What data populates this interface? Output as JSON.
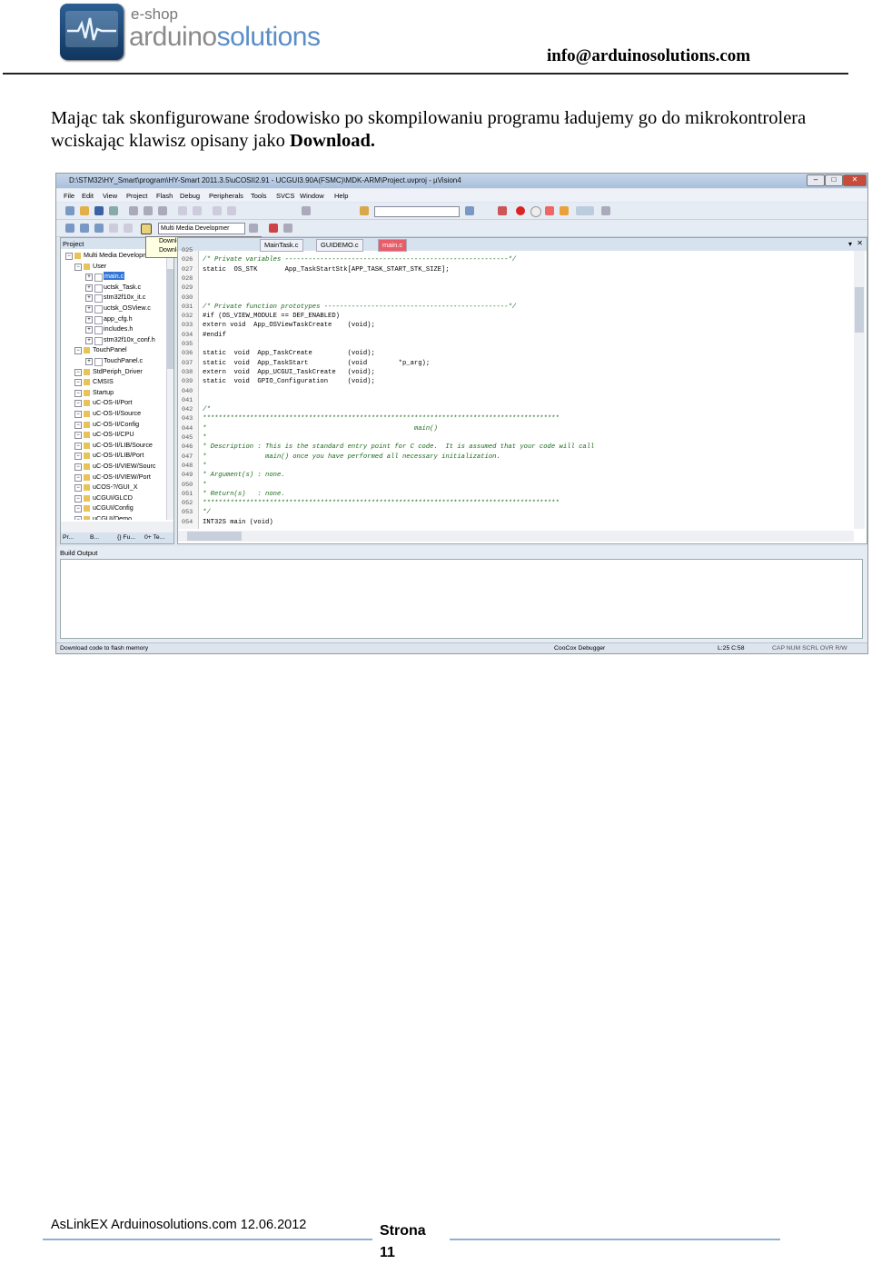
{
  "header": {
    "logo_small": "e-shop",
    "logo_part1": "arduino",
    "logo_part2": "solutions",
    "email": "info@arduinosolutions.com"
  },
  "paragraph": {
    "text": "Mając tak skonfigurowane środowisko po skompilowaniu programu ładujemy go do mikrokontrolera wciskając klawisz opisany jako ",
    "bold": "Download."
  },
  "ide": {
    "title": "D:\\STM32\\HY_Smart\\program\\HY-Smart 2011.3.5\\uCOSII2.91 - UCGUI3.90A(FSMC)\\MDK-ARM\\Project.uvproj - µVision4",
    "menu": [
      "File",
      "Edit",
      "View",
      "Project",
      "Flash",
      "Debug",
      "Peripherals",
      "Tools",
      "SVCS",
      "Window",
      "Help"
    ],
    "target": "Multi Media Developmer",
    "tooltip_title": "Download",
    "tooltip_text": "Download code to flash memory",
    "project_label": "Project",
    "tree": [
      {
        "label": "Multi Media Developmer",
        "level": 1
      },
      {
        "label": "User",
        "level": 2
      },
      {
        "label": "main.c",
        "level": 3,
        "selected": true
      },
      {
        "label": "uctsk_Task.c",
        "level": 3
      },
      {
        "label": "stm32f10x_it.c",
        "level": 3
      },
      {
        "label": "uctsk_OSView.c",
        "level": 3
      },
      {
        "label": "app_cfg.h",
        "level": 3
      },
      {
        "label": "includes.h",
        "level": 3
      },
      {
        "label": "stm32f10x_conf.h",
        "level": 3
      },
      {
        "label": "TouchPanel",
        "level": 2
      },
      {
        "label": "TouchPanel.c",
        "level": 3
      },
      {
        "label": "StdPeriph_Driver",
        "level": 2
      },
      {
        "label": "CMSIS",
        "level": 2
      },
      {
        "label": "Startup",
        "level": 2
      },
      {
        "label": "uC-OS-II/Port",
        "level": 2
      },
      {
        "label": "uC-OS-II/Source",
        "level": 2
      },
      {
        "label": "uC-OS-II/Config",
        "level": 2
      },
      {
        "label": "uC-OS-II/CPU",
        "level": 2
      },
      {
        "label": "uC-OS-II/LIB/Source",
        "level": 2
      },
      {
        "label": "uC-OS-II/LIB/Port",
        "level": 2
      },
      {
        "label": "uC-OS-II/VIEW/Sourc",
        "level": 2
      },
      {
        "label": "uC-OS-II/VIEW/Port",
        "level": 2
      },
      {
        "label": "uCOS-?/GUI_X",
        "level": 2
      },
      {
        "label": "uCGUI/GLCD",
        "level": 2
      },
      {
        "label": "uCGUI/Config",
        "level": 2
      },
      {
        "label": "uCGUI/Demo",
        "level": 2
      }
    ],
    "panel_tabs": [
      "Pr...",
      "B...",
      "{} Fu...",
      "0+ Te..."
    ],
    "tabs": [
      "MainTask.c",
      "GUIDEMO.c",
      "main.c"
    ],
    "code": [
      {
        "n": "025",
        "t": ""
      },
      {
        "n": "026",
        "t": "/* Private variables ---------------------------------------------------------*/",
        "c": true
      },
      {
        "n": "027",
        "t": "static  OS_STK       App_TaskStartStk[APP_TASK_START_STK_SIZE];"
      },
      {
        "n": "028",
        "t": ""
      },
      {
        "n": "029",
        "t": ""
      },
      {
        "n": "030",
        "t": ""
      },
      {
        "n": "031",
        "t": "/* Private function prototypes -----------------------------------------------*/",
        "c": true
      },
      {
        "n": "032",
        "t": "#if (OS_VIEW_MODULE == DEF_ENABLED)"
      },
      {
        "n": "033",
        "t": "extern void  App_OSViewTaskCreate    (void);"
      },
      {
        "n": "034",
        "t": "#endif"
      },
      {
        "n": "035",
        "t": ""
      },
      {
        "n": "036",
        "t": "static  void  App_TaskCreate         (void);"
      },
      {
        "n": "037",
        "t": "static  void  App_TaskStart          (void        *p_arg);"
      },
      {
        "n": "038",
        "t": "extern  void  App_UCGUI_TaskCreate   (void);"
      },
      {
        "n": "039",
        "t": "static  void  GPIO_Configuration     (void);"
      },
      {
        "n": "040",
        "t": ""
      },
      {
        "n": "041",
        "t": ""
      },
      {
        "n": "042",
        "t": "/*",
        "c": true
      },
      {
        "n": "043",
        "t": "*******************************************************************************************",
        "c": true
      },
      {
        "n": "044",
        "t": "*                                                     main()",
        "c": true
      },
      {
        "n": "045",
        "t": "*",
        "c": true
      },
      {
        "n": "046",
        "t": "* Description : This is the standard entry point for C code.  It is assumed that your code will call",
        "c": true
      },
      {
        "n": "047",
        "t": "*               main() once you have performed all necessary initialization.",
        "c": true
      },
      {
        "n": "048",
        "t": "*",
        "c": true
      },
      {
        "n": "049",
        "t": "* Argument(s) : none.",
        "c": true
      },
      {
        "n": "050",
        "t": "*",
        "c": true
      },
      {
        "n": "051",
        "t": "* Return(s)   : none.",
        "c": true
      },
      {
        "n": "052",
        "t": "*******************************************************************************************",
        "c": true
      },
      {
        "n": "053",
        "t": "*/",
        "c": true
      },
      {
        "n": "054",
        "t": "INT32S main (void)"
      }
    ],
    "build_output": "Build Output",
    "status_left": "Download code to flash memory",
    "status_debugger": "CooCox Debugger",
    "status_pos": "L:25 C:58",
    "status_flags": "CAP  NUM  SCRL  OVR  R/W"
  },
  "footer": {
    "left": "AsLinkEX  Arduinosolutions.com 12.06.2012",
    "page_label": "Strona",
    "page_number": "11"
  }
}
